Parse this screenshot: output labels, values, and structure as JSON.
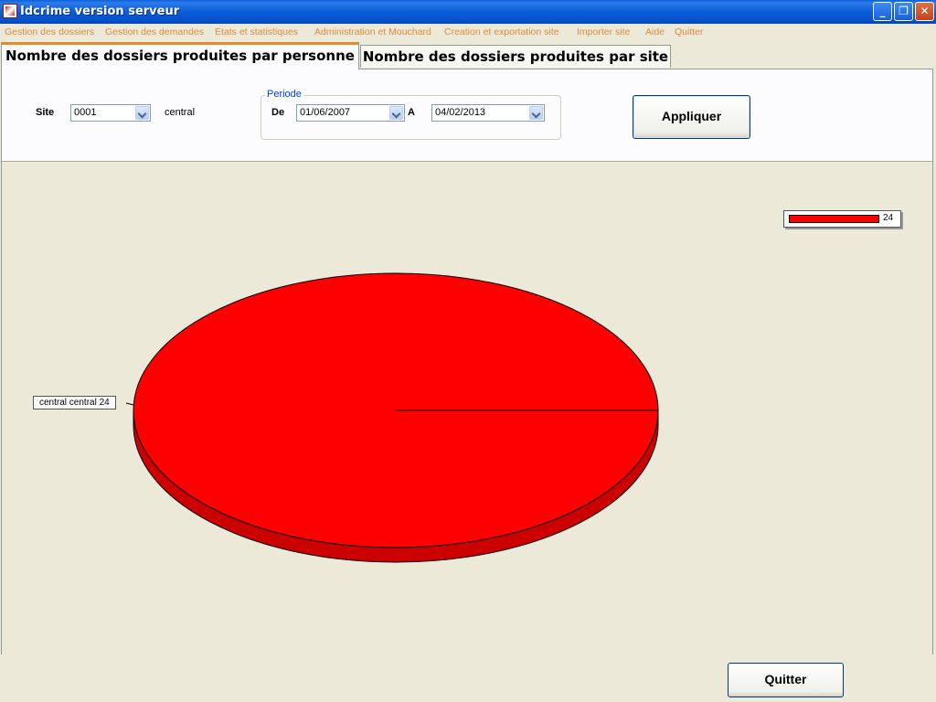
{
  "window": {
    "title": "Idcrime version serveur",
    "minimize_glyph": "_",
    "maximize_glyph": "❐",
    "close_glyph": "✕"
  },
  "menu": [
    "Gestion des dossiers",
    "Gestion des demandes",
    "Etats et statistiques",
    "Administration et Mouchard",
    "Creation et exportation site",
    "Importer site",
    "Aide",
    "Quitter"
  ],
  "tabs": [
    {
      "label": "Nombre des dossiers produites par personne",
      "active": true
    },
    {
      "label": "Nombre des dossiers produites par site",
      "active": false
    }
  ],
  "filters": {
    "site_label": "Site",
    "site_value": "0001",
    "site_name": "central",
    "periode_label": "Periode",
    "de_label": "De",
    "de_value": "01/06/2007",
    "a_label": "A",
    "a_value": "04/02/2013",
    "apply_label": "Appliquer"
  },
  "chart_data": {
    "type": "pie",
    "categories": [
      "central  central"
    ],
    "values": [
      24
    ],
    "slice_labels": [
      "central  central  24"
    ],
    "legend": [
      "24"
    ],
    "legend_position": "top-right",
    "colors": [
      "#FF0000"
    ]
  },
  "footer": {
    "quit_label": "Quitter"
  },
  "colors": {
    "menu_text": "#E08A3C",
    "slice": "#FF0000",
    "slice_side": "#CC0000",
    "title_bar": "#0A5ED8"
  }
}
